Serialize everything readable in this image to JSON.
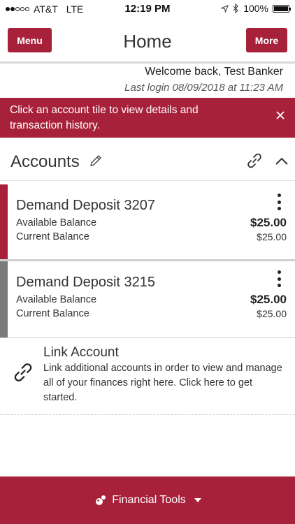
{
  "status": {
    "carrier": "AT&T",
    "network": "LTE",
    "time": "12:19 PM",
    "battery": "100%",
    "battery_level": 1.0,
    "signal_bars": [
      true,
      true,
      false,
      false,
      false
    ]
  },
  "nav": {
    "menu_label": "Menu",
    "title": "Home",
    "more_label": "More"
  },
  "welcome": {
    "greeting": "Welcome back, Test Banker",
    "last_login": "Last login 08/09/2018 at 11:23 AM"
  },
  "banner": {
    "message": "Click an account tile to view details and transaction history."
  },
  "accounts": {
    "title": "Accounts",
    "items": [
      {
        "name": "Demand Deposit 3207",
        "available_label": "Available Balance",
        "available_amount": "$25.00",
        "current_label": "Current Balance",
        "current_amount": "$25.00"
      },
      {
        "name": "Demand Deposit 3215",
        "available_label": "Available Balance",
        "available_amount": "$25.00",
        "current_label": "Current Balance",
        "current_amount": "$25.00"
      }
    ]
  },
  "link_account": {
    "title": "Link Account",
    "description": "Link additional accounts in order to view and manage all of your finances right here. Click here to get started."
  },
  "footer": {
    "label": "Financial Tools"
  },
  "colors": {
    "brand": "#a8213a",
    "inactive_accent": "#7a7a7a"
  }
}
